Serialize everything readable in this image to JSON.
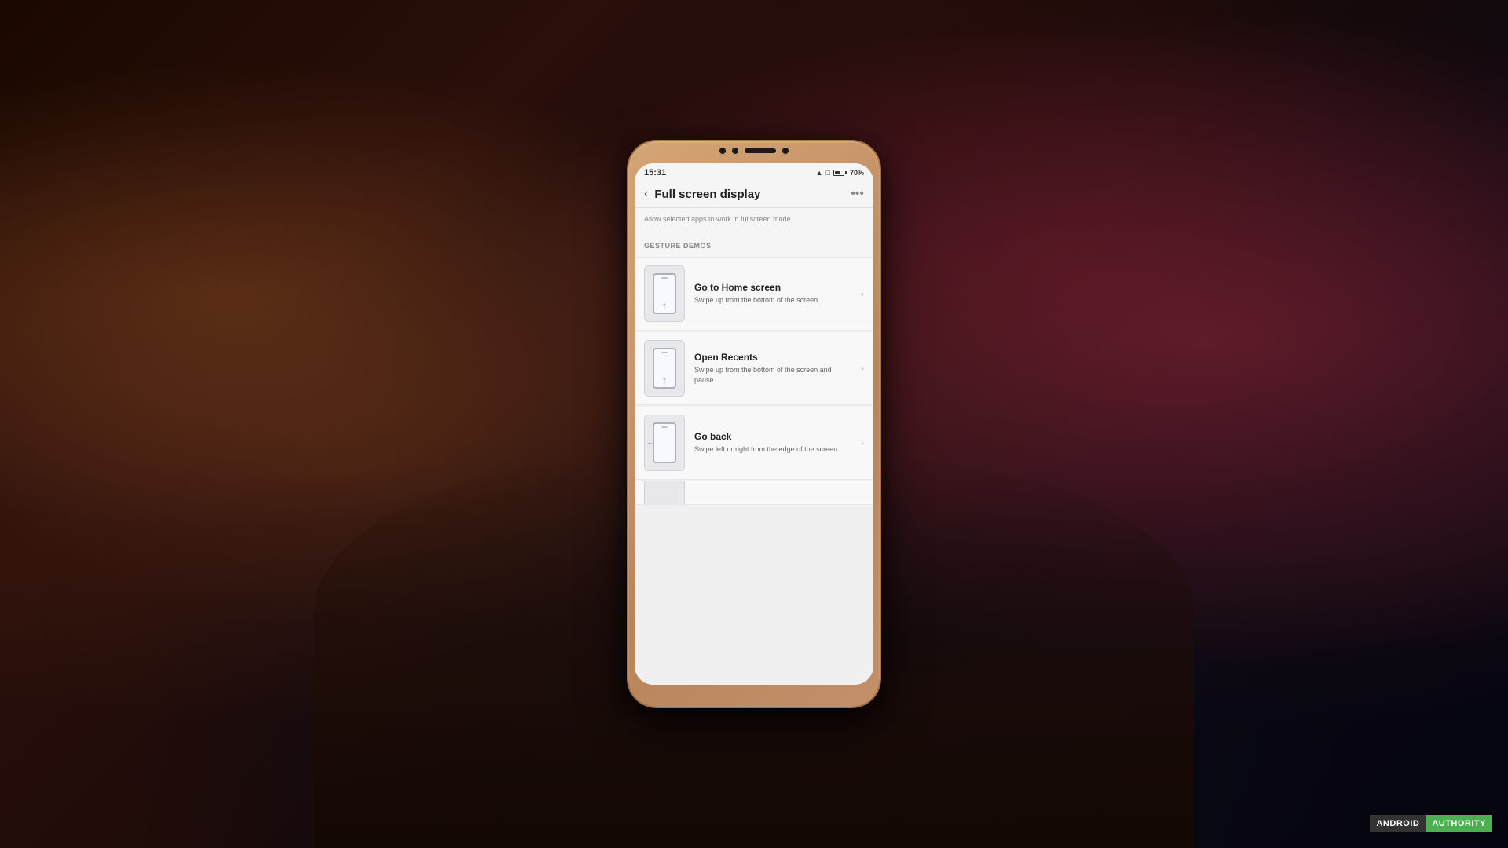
{
  "background": {
    "description": "Dark room background with hand holding phone"
  },
  "phone": {
    "status_bar": {
      "time": "15:31",
      "battery_percent": "70%",
      "battery_label": "70"
    },
    "header": {
      "back_label": "‹",
      "title": "Full screen display",
      "more_label": "•••"
    },
    "subtitle": "Allow selected apps to work in fullscreen mode",
    "section": {
      "title": "GESTURE DEMOS"
    },
    "gesture_items": [
      {
        "id": "go-home",
        "title": "Go to Home screen",
        "description": "Swipe up from the bottom of the screen",
        "gesture_type": "swipe-up"
      },
      {
        "id": "open-recents",
        "title": "Open Recents",
        "description": "Swipe up from the bottom of the screen and pause",
        "gesture_type": "swipe-up-pause"
      },
      {
        "id": "go-back",
        "title": "Go back",
        "description": "Swipe left or right from the edge of the screen",
        "gesture_type": "swipe-left-right"
      }
    ],
    "partial_item": true
  },
  "watermark": {
    "android_label": "ANDROID",
    "authority_label": "AUTHORITY"
  }
}
